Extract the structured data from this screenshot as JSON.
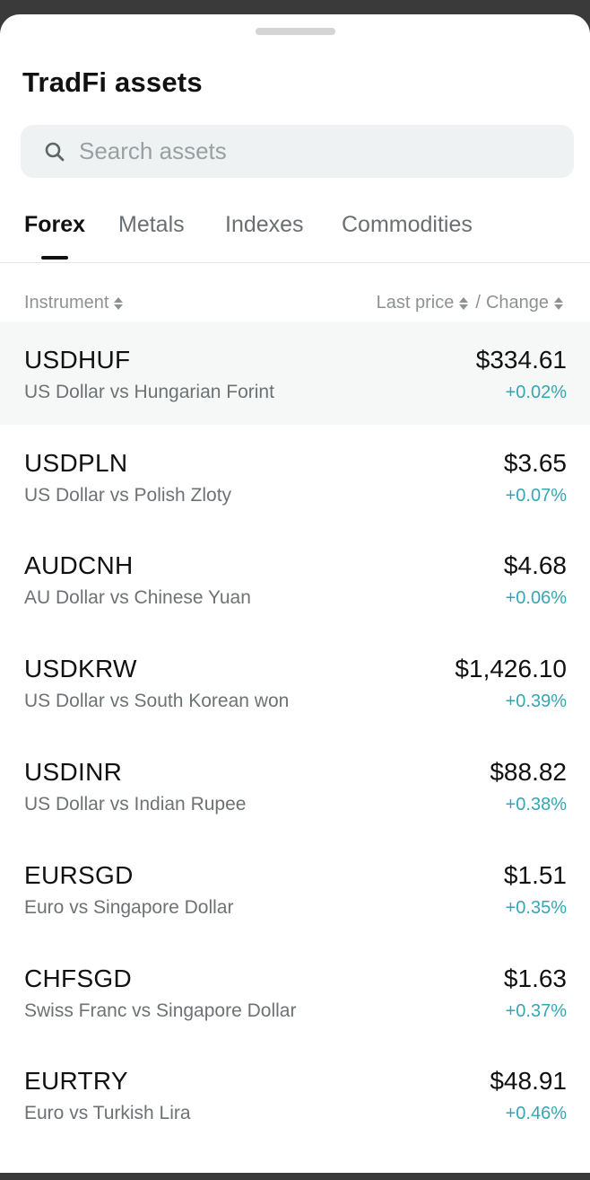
{
  "title": "TradFi assets",
  "search": {
    "placeholder": "Search assets"
  },
  "tabs": [
    {
      "label": "Forex",
      "active": true
    },
    {
      "label": "Metals",
      "active": false
    },
    {
      "label": "Indexes",
      "active": false
    },
    {
      "label": "Commodities",
      "active": false
    }
  ],
  "columns": {
    "instrument": "Instrument",
    "last_price": "Last price",
    "separator": "/",
    "change": "Change"
  },
  "rows": [
    {
      "symbol": "USDHUF",
      "name": "US Dollar vs Hungarian Forint",
      "price": "$334.61",
      "change": "+0.02%"
    },
    {
      "symbol": "USDPLN",
      "name": "US Dollar vs Polish Zloty",
      "price": "$3.65",
      "change": "+0.07%"
    },
    {
      "symbol": "AUDCNH",
      "name": "AU Dollar vs Chinese Yuan",
      "price": "$4.68",
      "change": "+0.06%"
    },
    {
      "symbol": "USDKRW",
      "name": "US Dollar vs South Korean won",
      "price": "$1,426.10",
      "change": "+0.39%"
    },
    {
      "symbol": "USDINR",
      "name": "US Dollar vs Indian Rupee",
      "price": "$88.82",
      "change": "+0.38%"
    },
    {
      "symbol": "EURSGD",
      "name": "Euro vs Singapore Dollar",
      "price": "$1.51",
      "change": "+0.35%"
    },
    {
      "symbol": "CHFSGD",
      "name": "Swiss Franc vs Singapore Dollar",
      "price": "$1.63",
      "change": "+0.37%"
    },
    {
      "symbol": "EURTRY",
      "name": "Euro vs Turkish Lira",
      "price": "$48.91",
      "change": "+0.46%"
    }
  ],
  "colors": {
    "positive_change": "#35a6b4",
    "highlight_row": "#f6f7f7",
    "search_bg": "#eff2f2"
  },
  "icons": {
    "search": "search-icon",
    "sort": "sort-icon"
  }
}
